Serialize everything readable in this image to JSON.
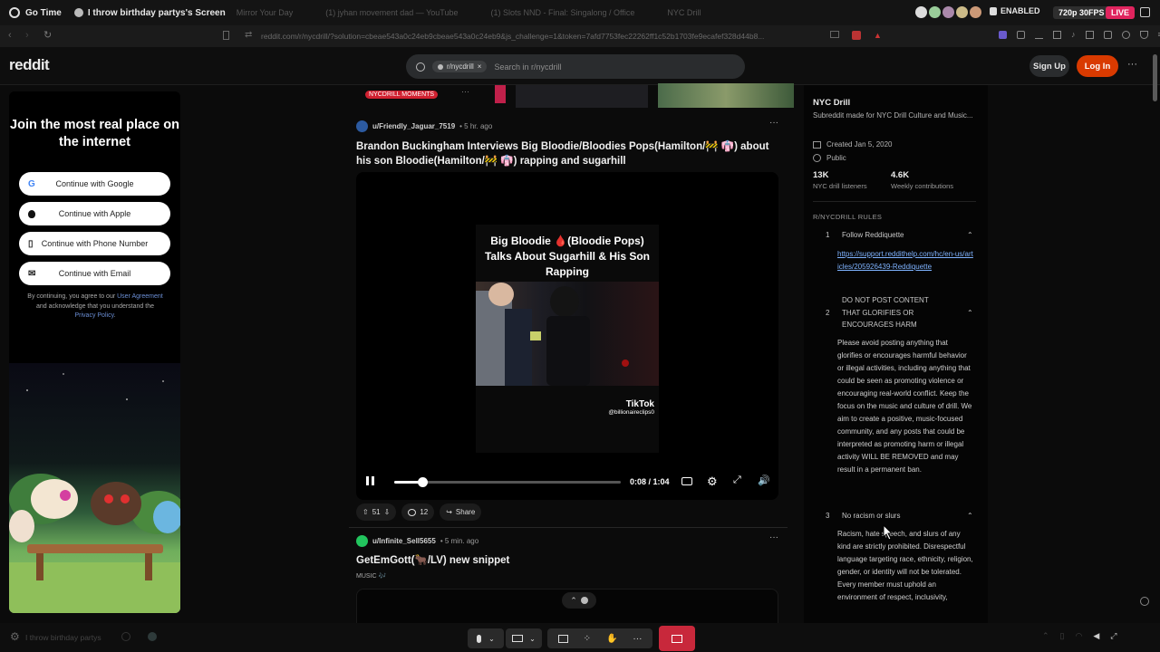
{
  "share": {
    "app": "Go Time",
    "screen_title": "I throw birthday partys's Screen",
    "tabs": [
      "Mirror Your Day",
      "(1) jyhan movement dad — YouTube",
      "(1) Slots NND - Final: Singalong / Office",
      "NYC Drill"
    ],
    "status_enabled": "ENABLED",
    "quality": "720p 30FPS",
    "live": "LIVE"
  },
  "browser": {
    "url": "reddit.com/r/nycdrill/?solution=cbeae543a0c24eb9cbeae543a0c24eb9&js_challenge=1&token=7afd7753fec22262ff1c52b1703fe9ecafef328d44b8..."
  },
  "reddit": {
    "logo": "reddit",
    "search_chip": "r/nycdrill",
    "search_placeholder": "Search in r/nycdrill",
    "signup": "Sign Up",
    "login": "Log In",
    "more": "···"
  },
  "promo": {
    "headline": "Join the most real place on the internet",
    "buttons": [
      {
        "label": "Continue with Google",
        "icon": "G"
      },
      {
        "label": "Continue with Apple",
        "icon": ""
      },
      {
        "label": "Continue with Phone Number",
        "icon": "▯"
      },
      {
        "label": "Continue with Email",
        "icon": "✉"
      }
    ],
    "terms_pre": "By continuing, you agree to our ",
    "terms_link1": "User Agreement",
    "terms_mid": " and acknowledge that you understand the ",
    "terms_link2": "Privacy Policy",
    "terms_end": "."
  },
  "feed": {
    "prev_flair": "NYCDRILL MOMENTS",
    "post1": {
      "author": "u/Friendly_Jaguar_7519",
      "time": "• 5 hr. ago",
      "title": "Brandon Buckingham Interviews Big Bloodie/Bloodies Pops(Hamilton/🚧 👘) about his son Bloodie(Hamilton/🚧 👘) rapping and sugarhill",
      "video_caption": "Big Bloodie 🩸(Bloodie Pops) Talks About Sugarhill & His Son Rapping",
      "watermark_brand": "TikTok",
      "watermark_handle": "@billionaireclips0",
      "time_display": "0:08 / 1:04",
      "progress": 0.125,
      "votes": "51",
      "comments": "12",
      "share": "Share"
    },
    "post2": {
      "author": "u/Infinite_Sell5655",
      "time": "• 5 min. ago",
      "title": "GetEmGott(🐂/LV) new snippet",
      "flair": "MUSIC 🎶"
    }
  },
  "sidebar": {
    "name": "NYC Drill",
    "desc": "Subreddit made for NYC Drill Culture and Music...",
    "created": "Created Jan 5, 2020",
    "visibility": "Public",
    "stat1_value": "13K",
    "stat1_label": "NYC drill listeners",
    "stat2_value": "4.6K",
    "stat2_label": "Weekly contributions",
    "rules_heading": "R/NYCDRILL RULES",
    "rules": [
      {
        "num": "1",
        "title": "Follow Reddiquette",
        "body": "https://support.reddithelp.com/hc/en-us/articles/205926439-Reddiquette"
      },
      {
        "num": "2",
        "title": "DO NOT POST CONTENT THAT GLORIFIES OR ENCOURAGES HARM",
        "body": "Please avoid posting anything that glorifies or encourages harmful behavior or illegal activities, including anything that could be seen as promoting violence or encouraging real-world conflict. Keep the focus on the music and culture of drill. We aim to create a positive, music-focused community, and any posts that could be interpreted as promoting harm or illegal activity WILL BE REMOVED and may result in a permanent ban."
      },
      {
        "num": "3",
        "title": "No racism or slurs",
        "body": "Racism, hate speech, and slurs of any kind are strictly prohibited. Disrespectful language targeting race, ethnicity, religion, gender, or identity will not be tolerated. Every member must uphold an environment of respect, inclusivity,"
      }
    ]
  },
  "bottom": {
    "taskbar_label": "I throw birthday partys"
  },
  "colors": {
    "accent_orange": "#d93a00",
    "live_red": "#e0245e",
    "end_call": "#c8283b",
    "link_blue": "#7fb3ff"
  }
}
